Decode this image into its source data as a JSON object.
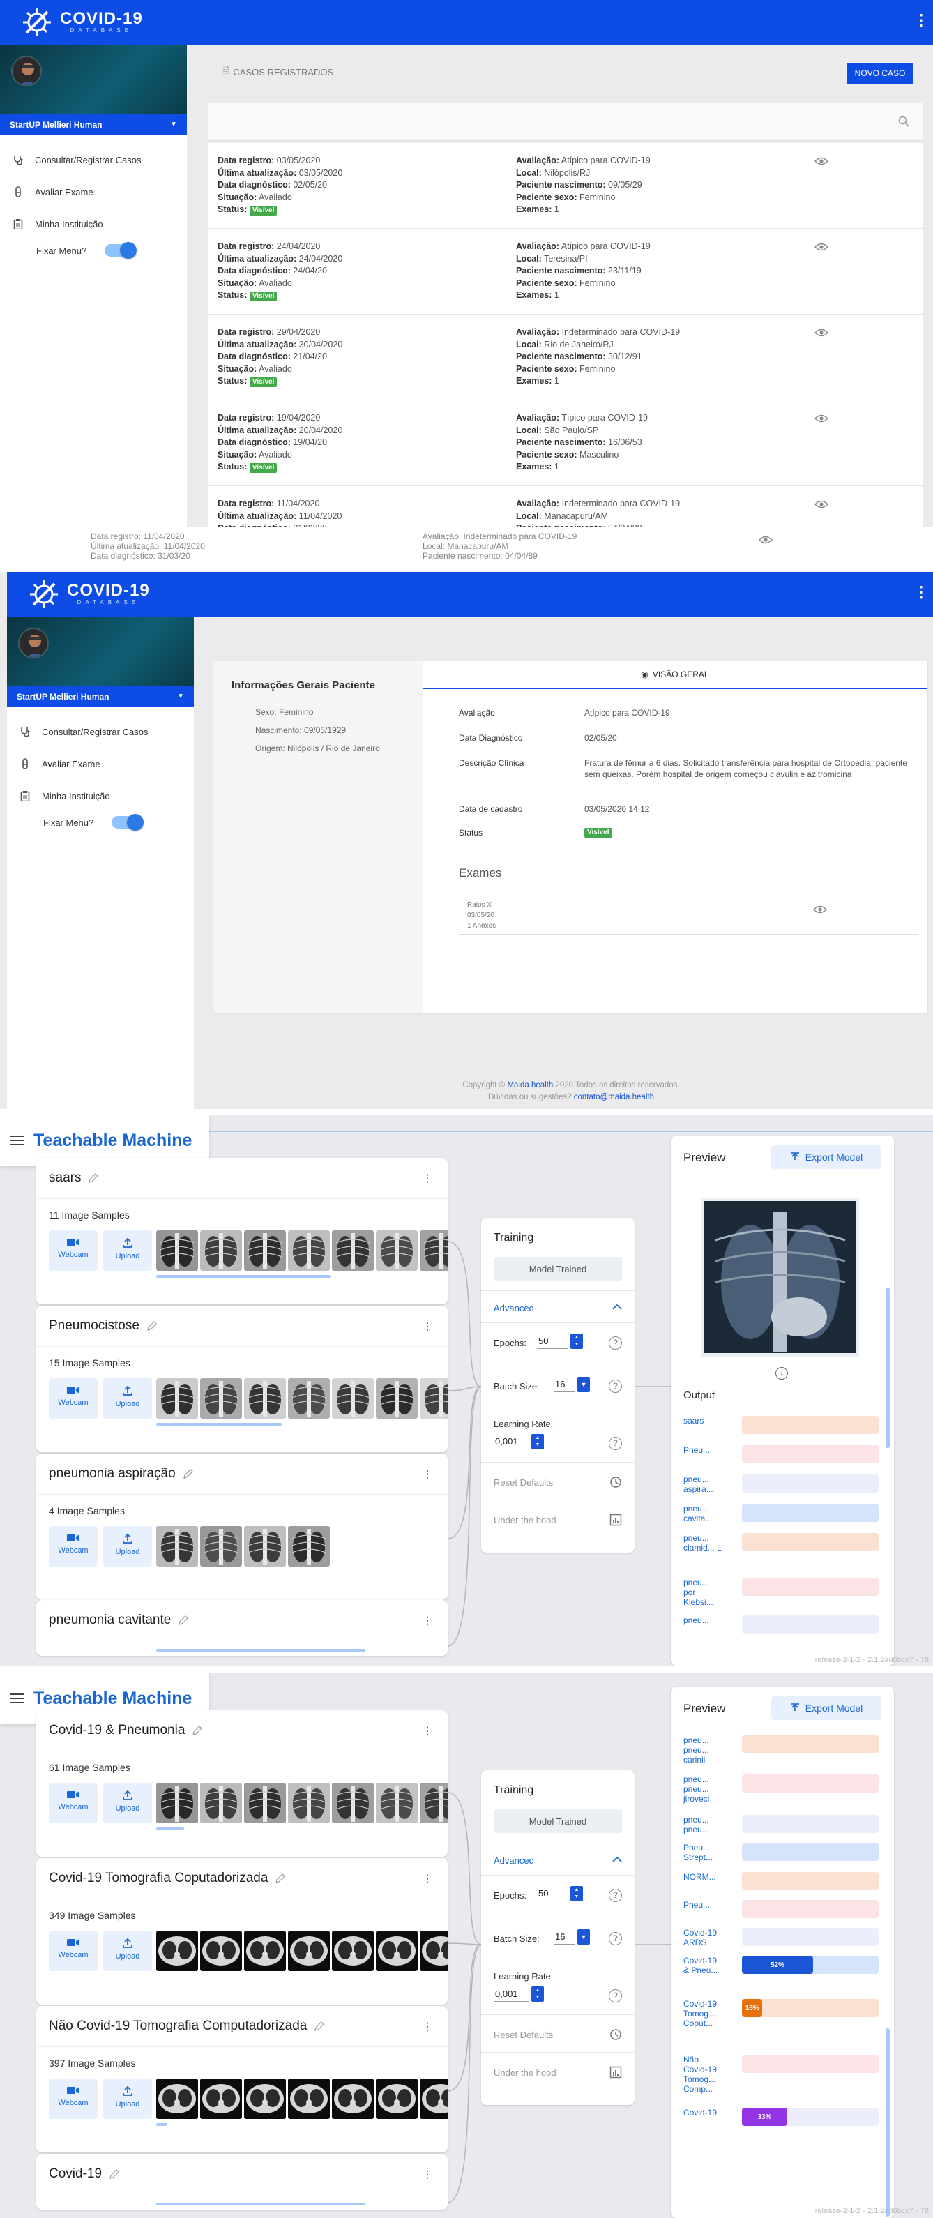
{
  "covid_list": {
    "logo_title": "COVID-19",
    "logo_subtitle": "DATABASE",
    "user_name": "StartUP Mellieri Human",
    "nav": [
      {
        "label": "Consultar/Registrar Casos",
        "icon": "stethoscope-icon"
      },
      {
        "label": "Avaliar Exame",
        "icon": "flask-icon"
      },
      {
        "label": "Minha Instituição",
        "icon": "clipboard-icon"
      }
    ],
    "fix_menu_label": "Fixar Menu?",
    "section_title": "CASOS REGISTRADOS",
    "new_case_label": "NOVO CASO",
    "labels": {
      "registro": "Data registro:",
      "atualizacao": "Última atualização:",
      "diagnostico": "Data diagnóstico:",
      "situacao": "Situação:",
      "status": "Status:",
      "avaliacao": "Avaliação:",
      "local": "Local:",
      "nascimento": "Paciente nascimento:",
      "sexo": "Paciente sexo:",
      "exames": "Exames:"
    },
    "cases": [
      {
        "registro": "03/05/2020",
        "atualizacao": "03/05/2020",
        "diagnostico": "02/05/20",
        "situacao": "Avaliado",
        "status": "Visível",
        "avaliacao": "Atípico para COVID-19",
        "local": "Nilópolis/RJ",
        "nascimento": "09/05/29",
        "sexo": "Feminino",
        "exames": "1"
      },
      {
        "registro": "24/04/2020",
        "atualizacao": "24/04/2020",
        "diagnostico": "24/04/20",
        "situacao": "Avaliado",
        "status": "Visível",
        "avaliacao": "Atípico para COVID-19",
        "local": "Teresina/PI",
        "nascimento": "23/11/19",
        "sexo": "Feminino",
        "exames": "1"
      },
      {
        "registro": "29/04/2020",
        "atualizacao": "30/04/2020",
        "diagnostico": "21/04/20",
        "situacao": "Avaliado",
        "status": "Visível",
        "avaliacao": "Indeterminado para COVID-19",
        "local": "Rio de Janeiro/RJ",
        "nascimento": "30/12/91",
        "sexo": "Feminino",
        "exames": "1"
      },
      {
        "registro": "19/04/2020",
        "atualizacao": "20/04/2020",
        "diagnostico": "19/04/20",
        "situacao": "Avaliado",
        "status": "Visível",
        "avaliacao": "Típico para COVID-19",
        "local": "São Paulo/SP",
        "nascimento": "16/06/53",
        "sexo": "Masculino",
        "exames": "1"
      },
      {
        "registro": "11/04/2020",
        "atualizacao": "11/04/2020",
        "diagnostico": "31/03/20",
        "situacao": "",
        "status": "",
        "avaliacao": "Indeterminado para COVID-19",
        "local": "Manacapuru/AM",
        "nascimento": "04/04/89",
        "sexo": "",
        "exames": ""
      }
    ]
  },
  "covid_detail": {
    "logo_title": "COVID-19",
    "logo_subtitle": "DATABASE",
    "user_name": "StartUP Mellieri Human",
    "nav": [
      {
        "label": "Consultar/Registrar Casos"
      },
      {
        "label": "Avaliar Exame"
      },
      {
        "label": "Minha Instituição"
      }
    ],
    "fix_menu_label": "Fixar Menu?",
    "patient_title": "Informações Gerais Paciente",
    "patient": {
      "sexo": "Sexo: Feminino",
      "nascimento": "Nascimento: 09/05/1929",
      "origem": "Origem: Nilópolis / Rio de Janeiro"
    },
    "tab_label": "VISÃO GERAL",
    "fields": [
      {
        "label": "Avaliação",
        "value": "Atípico para COVID-19"
      },
      {
        "label": "Data Diagnóstico",
        "value": "02/05/20"
      },
      {
        "label": "Descrição Clínica",
        "value": "Fratura de fêmur a 6 dias. Solicitado transferência para hospital de Ortopedia, paciente sem queixas. Porém hospital de origem começou clavulin e azitromicina"
      },
      {
        "label": "Data de cadastro",
        "value": "03/05/2020 14:12"
      },
      {
        "label": "Status",
        "value": "Visível"
      }
    ],
    "exams_title": "Exames",
    "exam": {
      "type": "Raios X",
      "date": "03/05/20",
      "annex": "1 Anexos"
    },
    "footer_prefix": "Copyright ©",
    "footer_link": "Maida.health",
    "footer_suffix": "2020 Todos os direitos reservados.",
    "footer_question": "Dúvidas ou sugestões?",
    "footer_email": "contato@maida.health"
  },
  "teachable_1": {
    "title": "Teachable Machine",
    "webcam_label": "Webcam",
    "upload_label": "Upload",
    "classes": [
      {
        "name": "saars",
        "samples": "11 Image Samples"
      },
      {
        "name": "Pneumocistose",
        "samples": "15 Image Samples"
      },
      {
        "name": "pneumonia aspiração",
        "samples": "4 Image Samples"
      },
      {
        "name": "pneumonia cavitante",
        "samples": ""
      }
    ],
    "training": {
      "title": "Training",
      "button": "Model Trained",
      "advanced": "Advanced",
      "epochs_label": "Epochs:",
      "epochs": "50",
      "batch_label": "Batch Size:",
      "batch": "16",
      "lr_label": "Learning Rate:",
      "lr": "0,001",
      "reset": "Reset Defaults",
      "hood": "Under the hood"
    },
    "preview": {
      "title": "Preview",
      "export": "Export Model",
      "output_title": "Output",
      "outputs": [
        {
          "label": "saars",
          "value": 0,
          "color": "#fbe1d4"
        },
        {
          "label": "Pneu...",
          "value": 0,
          "color": "#fce4e6"
        },
        {
          "label": "pneu... aspira...",
          "value": 0,
          "color": "#eceefc"
        },
        {
          "label": "pneu... cavita...",
          "value": 0,
          "color": "#d5e4fb"
        },
        {
          "label": "pneu... clamid... L",
          "value": 0,
          "color": "#fbe1d4"
        },
        {
          "label": "pneu... por Klebsi...",
          "value": 0,
          "color": "#fce4e6"
        },
        {
          "label": "pneu...",
          "value": 0,
          "color": "#eceefc"
        }
      ]
    },
    "release": "release-2-1-2 - 2.1.2#d6bcc7 - 78"
  },
  "teachable_2": {
    "title": "Teachable Machine",
    "webcam_label": "Webcam",
    "upload_label": "Upload",
    "classes": [
      {
        "name": "Covid-19 & Pneumonia",
        "samples": "61 Image Samples"
      },
      {
        "name": "Covid-19 Tomografia Coputadorizada",
        "samples": "349 Image Samples"
      },
      {
        "name": "Não Covid-19 Tomografia Computadorizada",
        "samples": "397 Image Samples"
      },
      {
        "name": "Covid-19",
        "samples": ""
      }
    ],
    "training": {
      "title": "Training",
      "button": "Model Trained",
      "advanced": "Advanced",
      "epochs_label": "Epochs:",
      "epochs": "50",
      "batch_label": "Batch Size:",
      "batch": "16",
      "lr_label": "Learning Rate:",
      "lr": "0,001",
      "reset": "Reset Defaults",
      "hood": "Under the hood"
    },
    "preview": {
      "title": "Preview",
      "export": "Export Model",
      "outputs": [
        {
          "label": "pneu... pneu... carinii",
          "value": 0,
          "color": "#fbe1d4"
        },
        {
          "label": "pneu... pneu... jiroveci",
          "value": 0,
          "color": "#fce4e6"
        },
        {
          "label": "pneu... pneu...",
          "value": 0,
          "color": "#eceefc"
        },
        {
          "label": "Pneu... Strept...",
          "value": 0,
          "color": "#d5e4fb"
        },
        {
          "label": "NORM...",
          "value": 0,
          "color": "#fbe1d4"
        },
        {
          "label": "Pneu...",
          "value": 0,
          "color": "#fce4e6"
        },
        {
          "label": "Covid-19 ARDS",
          "value": 0,
          "color": "#eceefc"
        },
        {
          "label": "Covid-19 & Pneu...",
          "value": 52,
          "text": "52%",
          "color": "#d5e4fb",
          "fill": "#1a56d6"
        },
        {
          "label": "Covid-19 Tomog... Coput...",
          "value": 15,
          "text": "15%",
          "color": "#fbe1d4",
          "fill": "#e8710a"
        },
        {
          "label": "Não Covid-19 Tomog... Comp...",
          "value": 0,
          "color": "#fce4e6"
        },
        {
          "label": "Covid-19",
          "value": 33,
          "text": "33%",
          "color": "#eceefc",
          "fill": "#9334e6"
        }
      ]
    },
    "release": "release-2-1-2 - 2.1.2#d6bcc7 - 78"
  }
}
